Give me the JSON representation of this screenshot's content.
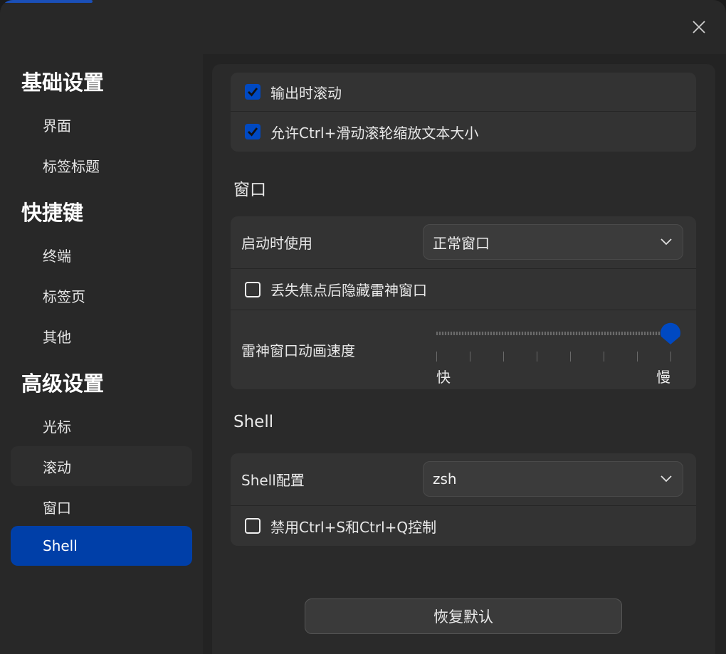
{
  "sidebar": {
    "groups": [
      {
        "title": "基础设置",
        "items": [
          "界面",
          "标签标题"
        ]
      },
      {
        "title": "快捷键",
        "items": [
          "终端",
          "标签页",
          "其他"
        ]
      },
      {
        "title": "高级设置",
        "items": [
          "光标",
          "滚动",
          "窗口",
          "Shell"
        ]
      }
    ],
    "active_item": "Shell",
    "hovered_item": "滚动"
  },
  "scroll_card": {
    "scroll_on_output": {
      "label": "输出时滚动",
      "checked": true
    },
    "ctrl_wheel_zoom": {
      "label": "允许Ctrl+滑动滚轮缩放文本大小",
      "checked": true
    }
  },
  "window_section": {
    "title": "窗口",
    "startup_label": "启动时使用",
    "startup_value": "正常窗口",
    "hide_on_focus_loss": {
      "label": "丢失焦点后隐藏雷神窗口",
      "checked": false
    },
    "animation_label": "雷神窗口动画速度",
    "animation_min_label": "快",
    "animation_max_label": "慢",
    "animation_value": 1.0
  },
  "shell_section": {
    "title": "Shell",
    "config_label": "Shell配置",
    "config_value": "zsh",
    "disable_flow_control": {
      "label": "禁用Ctrl+S和Ctrl+Q控制",
      "checked": false
    }
  },
  "restore_button": "恢复默认",
  "colors": {
    "accent": "#0049c2",
    "active_nav": "#003fa8",
    "background": "#282828"
  },
  "icons": {
    "close": "close-icon",
    "chevron": "chevron-down-icon",
    "check": "checkmark-icon"
  }
}
